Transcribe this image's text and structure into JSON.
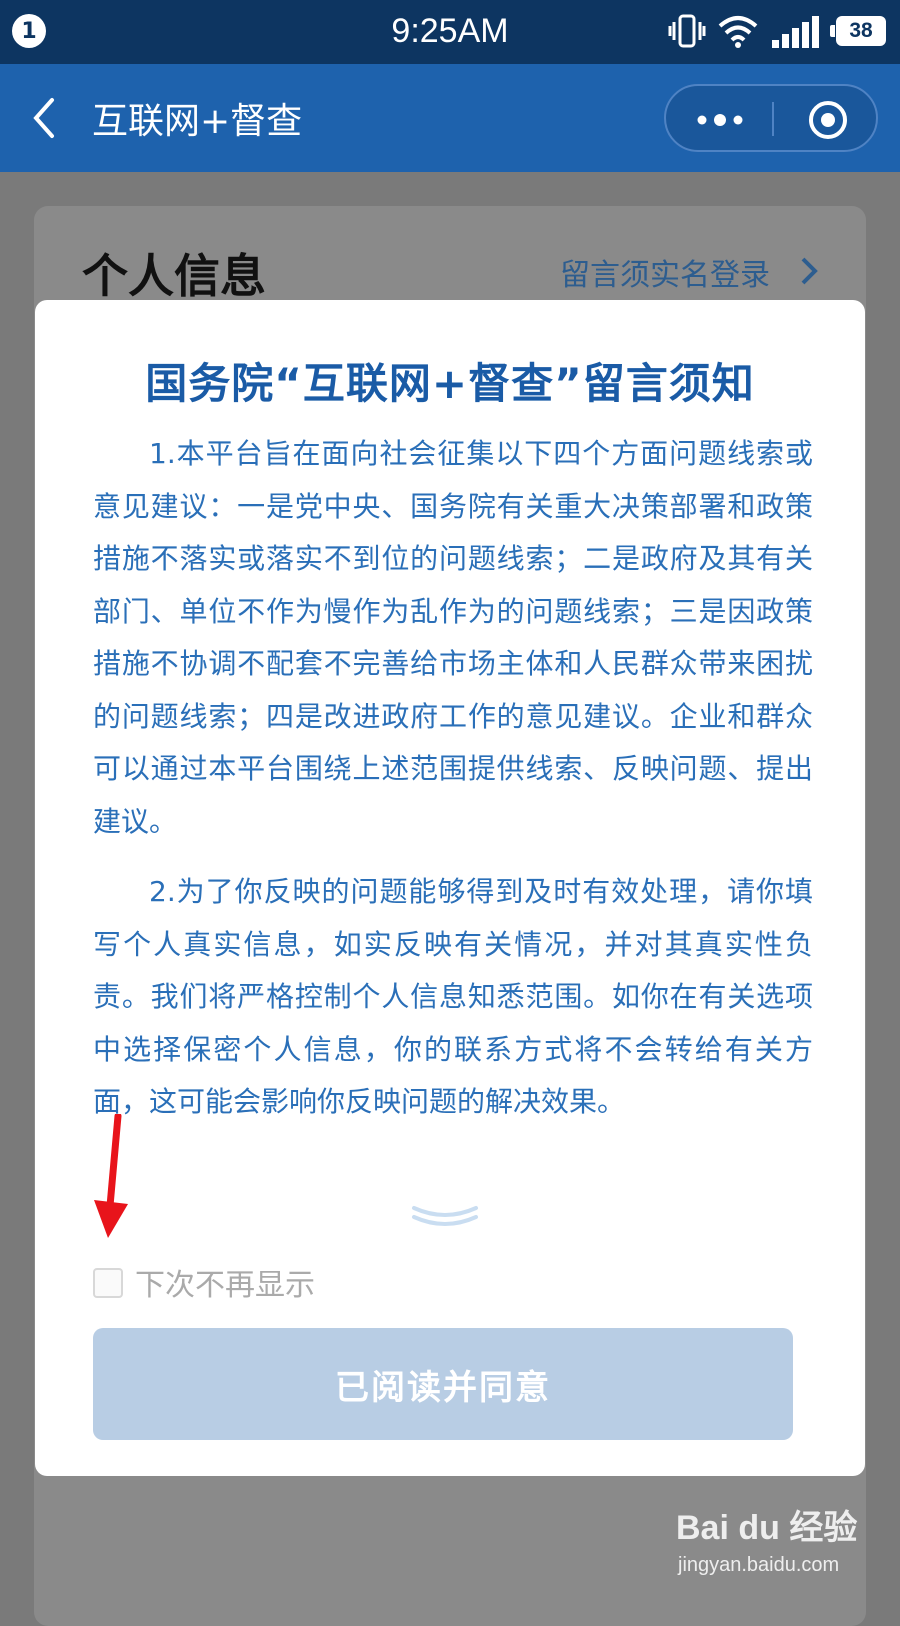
{
  "status_bar": {
    "notification_count": "1",
    "time": "9:25AM",
    "battery": "38"
  },
  "nav": {
    "title": "互联网+督查"
  },
  "background_page": {
    "section_title": "个人信息",
    "login_hint": "留言须实名登录"
  },
  "notice": {
    "title": "国务院“互联网+督查”留言须知",
    "paragraphs": [
      "1.本平台旨在面向社会征集以下四个方面问题线索或意见建议：一是党中央、国务院有关重大决策部署和政策措施不落实或落实不到位的问题线索；二是政府及其有关部门、单位不作为慢作为乱作为的问题线索；三是因政策措施不协调不配套不完善给市场主体和人民群众带来困扰的问题线索；四是改进政府工作的意见建议。企业和群众可以通过本平台围绕上述范围提供线索、反映问题、提出建议。",
      "2.为了你反映的问题能够得到及时有效处理，请你填写个人真实信息，如实反映有关情况，并对其真实性负责。我们将严格控制个人信息知悉范围。如你在有关选项中选择保密个人信息，你的联系方式将不会转给有关方面，这可能会影响你反映问题的解决效果。"
    ],
    "dont_show_label": "下次不再显示",
    "dont_show_checked": false,
    "agree_button": "已阅读并同意"
  },
  "watermark": {
    "logo": "Bai du 经验",
    "url": "jingyan.baidu.com"
  },
  "colors": {
    "status_bar": "#0d3561",
    "nav_bar": "#1e62ad",
    "notice_text": "#2a6fb8",
    "title_text": "#1a5ba6",
    "button_disabled": "#b8cde4",
    "annotation_arrow": "#e8141b"
  },
  "icons": {
    "back": "chevron-left-icon",
    "more": "more-dots-icon",
    "close": "target-circle-icon",
    "scroll_hint": "double-chevron-down-icon"
  }
}
